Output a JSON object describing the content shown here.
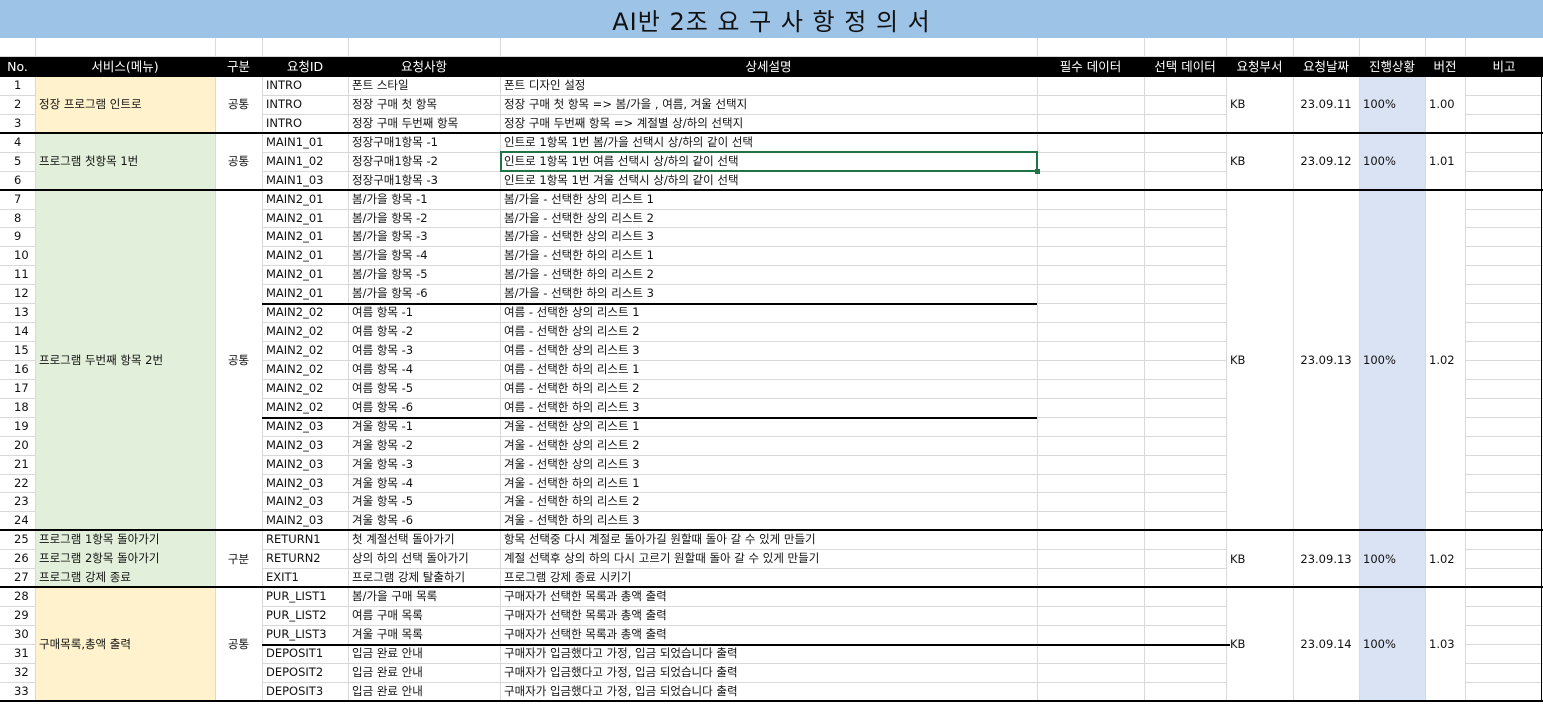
{
  "title": "AI반 2조 요 구 사 항   정 의 서",
  "headers": [
    "No.",
    "서비스(메뉴)",
    "구분",
    "요청ID",
    "요청사항",
    "상세설명",
    "필수 데이터",
    "선택 데이터",
    "요청부서",
    "요청날짜",
    "진행상황",
    "버전",
    "비고"
  ],
  "colors": {
    "title_bg": "#9dc3e6",
    "yellow": "#fff2cc",
    "green": "#e2efda",
    "blue": "#dae3f3",
    "selection": "#217346"
  },
  "rows": [
    {
      "no": "1",
      "id": "INTRO",
      "req": "폰트 스타일",
      "desc": "폰트 디자인 설정"
    },
    {
      "no": "2",
      "id": "INTRO",
      "req": "정장 구매 첫 항목",
      "desc": "정장 구매 첫 항목 => 봄/가을 , 여름, 겨울 선택지"
    },
    {
      "no": "3",
      "id": "INTRO",
      "req": "정장 구매 두번째 항목",
      "desc": "정장 구매 두번째 항목 => 계절별 상/하의 선택지"
    },
    {
      "no": "4",
      "id": "MAIN1_01",
      "req": "정장구매1항목 -1",
      "desc": "인트로 1항목 1번 봄/가을 선택시 상/하의 같이 선택"
    },
    {
      "no": "5",
      "id": "MAIN1_02",
      "req": "정장구매1항목 -2",
      "desc": "인트로 1항목 1번 여름 선택시 상/하의 같이 선택"
    },
    {
      "no": "6",
      "id": "MAIN1_03",
      "req": "정장구매1항목 -3",
      "desc": "인트로 1항목 1번 겨울 선택시 상/하의 같이 선택"
    },
    {
      "no": "7",
      "id": "MAIN2_01",
      "req": "봄/가을 항목 -1",
      "desc": "봄/가을 - 선택한 상의 리스트 1"
    },
    {
      "no": "8",
      "id": "MAIN2_01",
      "req": "봄/가을 항목 -2",
      "desc": "봄/가을 - 선택한 상의 리스트 2"
    },
    {
      "no": "9",
      "id": "MAIN2_01",
      "req": "봄/가을 항목 -3",
      "desc": "봄/가을 - 선택한 상의 리스트 3"
    },
    {
      "no": "10",
      "id": "MAIN2_01",
      "req": "봄/가을 항목 -4",
      "desc": "봄/가을 - 선택한 하의 리스트 1"
    },
    {
      "no": "11",
      "id": "MAIN2_01",
      "req": "봄/가을 항목 -5",
      "desc": "봄/가을 - 선택한 하의 리스트 2"
    },
    {
      "no": "12",
      "id": "MAIN2_01",
      "req": "봄/가을 항목 -6",
      "desc": "봄/가을 - 선택한 하의 리스트 3"
    },
    {
      "no": "13",
      "id": "MAIN2_02",
      "req": "여름 항목 -1",
      "desc": "여름 - 선택한 상의 리스트 1"
    },
    {
      "no": "14",
      "id": "MAIN2_02",
      "req": "여름 항목 -2",
      "desc": "여름 - 선택한 상의 리스트 2"
    },
    {
      "no": "15",
      "id": "MAIN2_02",
      "req": "여름 항목 -3",
      "desc": "여름 - 선택한 상의 리스트 3"
    },
    {
      "no": "16",
      "id": "MAIN2_02",
      "req": "여름 항목 -4",
      "desc": "여름 - 선택한 하의 리스트 1"
    },
    {
      "no": "17",
      "id": "MAIN2_02",
      "req": "여름 항목 -5",
      "desc": "여름 - 선택한 하의 리스트 2"
    },
    {
      "no": "18",
      "id": "MAIN2_02",
      "req": "여름 항목 -6",
      "desc": "여름 - 선택한 하의 리스트 3"
    },
    {
      "no": "19",
      "id": "MAIN2_03",
      "req": "겨울 항목 -1",
      "desc": "겨울 - 선택한 상의 리스트 1"
    },
    {
      "no": "20",
      "id": "MAIN2_03",
      "req": "겨울 항목 -2",
      "desc": "겨울 - 선택한 상의 리스트 2"
    },
    {
      "no": "21",
      "id": "MAIN2_03",
      "req": "겨울 항목 -3",
      "desc": "겨울 - 선택한 상의 리스트 3"
    },
    {
      "no": "22",
      "id": "MAIN2_03",
      "req": "겨울 항목 -4",
      "desc": "겨울 - 선택한 하의 리스트 1"
    },
    {
      "no": "23",
      "id": "MAIN2_03",
      "req": "겨울 항목 -5",
      "desc": "겨울 - 선택한 하의 리스트 2"
    },
    {
      "no": "24",
      "id": "MAIN2_03",
      "req": "겨울 항목 -6",
      "desc": "겨울 - 선택한 하의 리스트 3"
    },
    {
      "no": "25",
      "svc": "프로그램 1항목 돌아가기",
      "id": "RETURN1",
      "req": "첫 계절선택 돌아가기",
      "desc": "항목 선택중 다시 계절로 돌아가길 원할때 돌아 갈 수 있게 만들기"
    },
    {
      "no": "26",
      "svc": "프로그램 2항목 돌아가기",
      "id": "RETURN2",
      "req": "상의 하의 선택 돌아가기",
      "desc": "계절 선택후 상의 하의 다시 고르기 원할때 돌아 갈 수 있게 만들기"
    },
    {
      "no": "27",
      "svc": "프로그램 강제 종료",
      "id": "EXIT1",
      "req": "프로그램 강제 탈출하기",
      "desc": "프로그램 강제 종료 시키기"
    },
    {
      "no": "28",
      "id": "PUR_LIST1",
      "req": "봄/가을 구매 목록",
      "desc": "구매자가 선택한 목록과 총액 출력"
    },
    {
      "no": "29",
      "id": "PUR_LIST2",
      "req": "여름 구매 목록",
      "desc": "구매자가 선택한 목록과 총액 출력"
    },
    {
      "no": "30",
      "id": "PUR_LIST3",
      "req": "겨울 구매 목록",
      "desc": "구매자가 선택한 목록과 총액 출력"
    },
    {
      "no": "31",
      "id": "DEPOSIT1",
      "req": "입금 완료 안내",
      "desc": "구매자가 입금했다고 가정, 입금 되었습니다 출력"
    },
    {
      "no": "32",
      "id": "DEPOSIT2",
      "req": "입금 완료 안내",
      "desc": "구매자가 입금했다고 가정, 입금 되었습니다 출력"
    },
    {
      "no": "33",
      "id": "DEPOSIT3",
      "req": "입금 완료 안내",
      "desc": "구매자가 입금했다고 가정, 입금 되었습니다 출력"
    }
  ],
  "groups": [
    {
      "start": 1,
      "end": 3,
      "svc": "정장 프로그램 인트로",
      "color": "yellow",
      "div": "공통",
      "dept": "KB",
      "date": "23.09.11",
      "progress": "100%",
      "ver": "1.00"
    },
    {
      "start": 4,
      "end": 6,
      "svc": "프로그램 첫항목 1번",
      "color": "green",
      "div": "공통",
      "dept": "KB",
      "date": "23.09.12",
      "progress": "100%",
      "ver": "1.01"
    },
    {
      "start": 7,
      "end": 24,
      "svc": "프로그램 두번째 항목 2번",
      "color": "green",
      "div": "공통",
      "dept": "KB",
      "date": "23.09.13",
      "progress": "100%",
      "ver": "1.02"
    },
    {
      "start": 25,
      "end": 27,
      "svc": "",
      "color": "green",
      "div": "구분",
      "dept": "KB",
      "date": "23.09.13",
      "progress": "100%",
      "ver": "1.02"
    },
    {
      "start": 28,
      "end": 33,
      "svc": "구매목록,총액 출력",
      "color": "yellow",
      "div": "공통",
      "dept": "KB",
      "date": "23.09.14",
      "progress": "100%",
      "ver": "1.03"
    }
  ]
}
